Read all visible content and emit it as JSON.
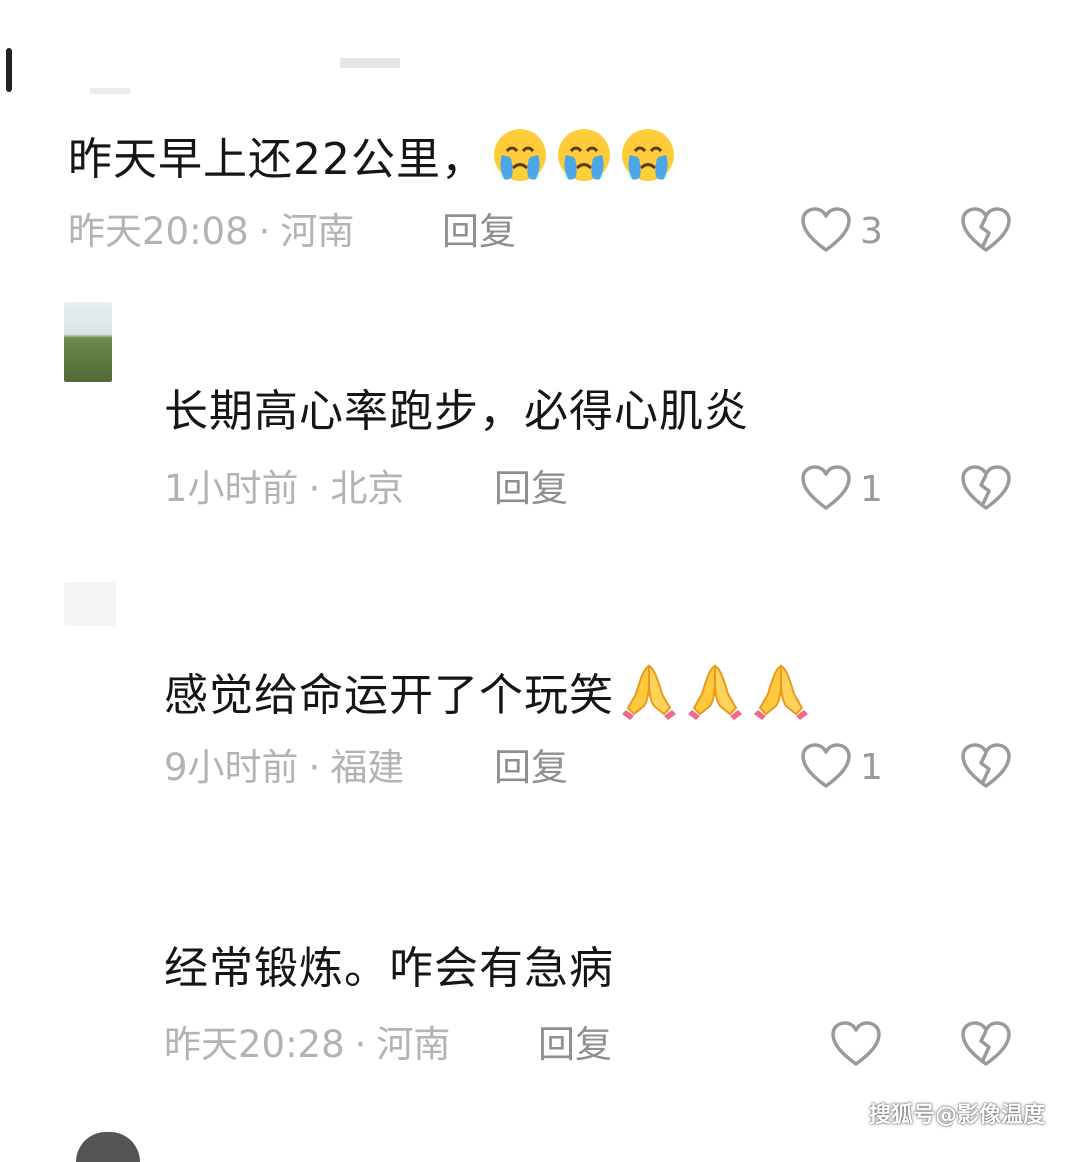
{
  "comments": [
    {
      "text": "昨天早上还22公里，",
      "emoji_names": [
        "crying-face",
        "crying-face",
        "crying-face"
      ],
      "time": "昨天20:08",
      "location": "河南",
      "reply": "回复",
      "likes": "3"
    },
    {
      "text": "长期高心率跑步，必得心肌炎",
      "time": "1小时前",
      "location": "北京",
      "reply": "回复",
      "likes": "1"
    },
    {
      "text": "感觉给命运开了个玩笑",
      "emoji_names": [
        "folded-hands",
        "folded-hands",
        "folded-hands"
      ],
      "time": "9小时前",
      "location": "福建",
      "reply": "回复",
      "likes": "1"
    },
    {
      "text": "经常锻炼。咋会有急病",
      "time": "昨天20:28",
      "location": "河南",
      "reply": "回复",
      "likes": ""
    }
  ],
  "separator": "·",
  "watermark": "搜狐号@影像温度",
  "colors": {
    "text": "#161616",
    "meta": "#b3b3b3",
    "reply": "#8f8f8f",
    "icon": "#9a9a9a"
  }
}
